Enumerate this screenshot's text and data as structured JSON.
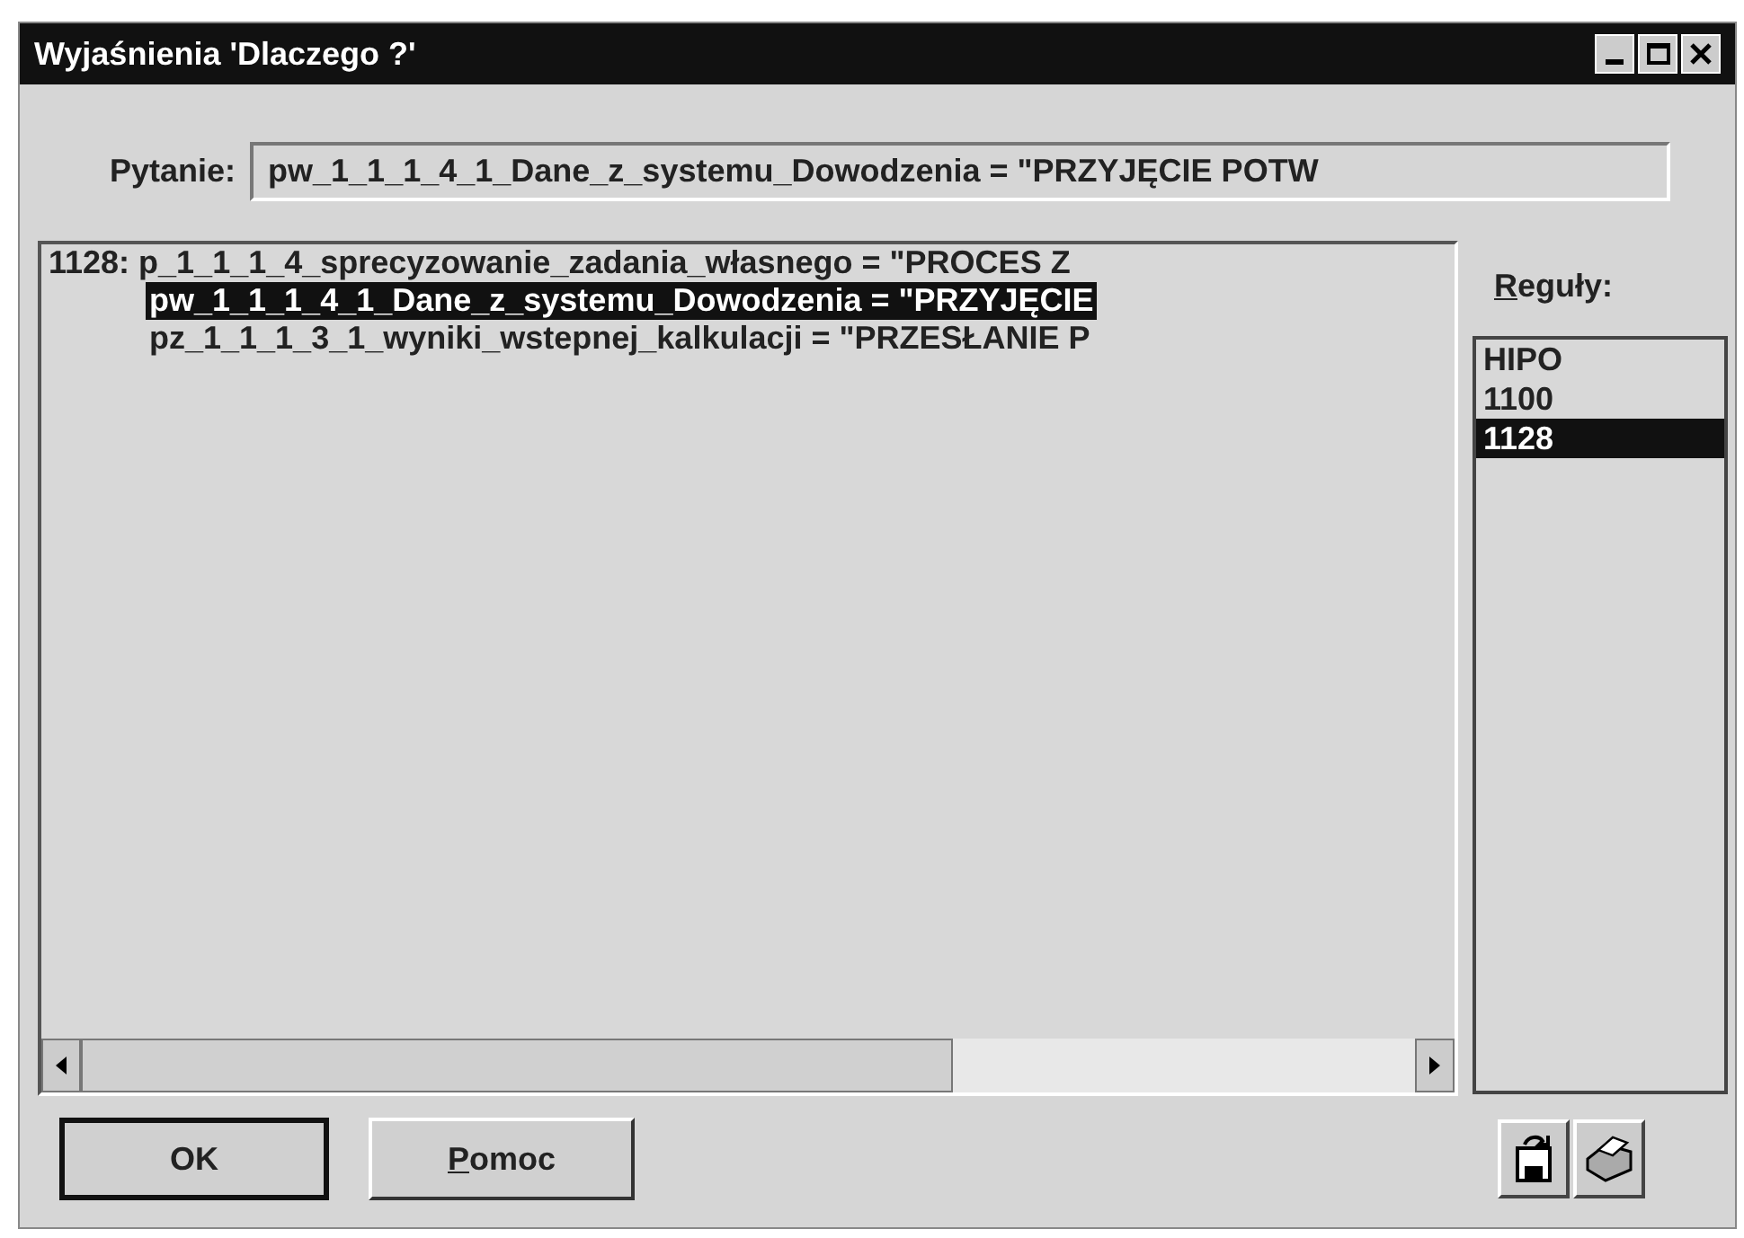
{
  "window": {
    "title": "Wyjaśnienia 'Dlaczego ?'"
  },
  "question": {
    "label": "Pytanie:",
    "value": "pw_1_1_1_4_1_Dane_z_systemu_Dowodzenia = \"PRZYJĘCIE POTW"
  },
  "tree": [
    {
      "text": "1128: p_1_1_1_4_sprecyzowanie_zadania_własnego = \"PROCES Z",
      "selected": false,
      "children": [
        {
          "text": "pw_1_1_1_4_1_Dane_z_systemu_Dowodzenia = \"PRZYJĘCIE",
          "selected": true
        },
        {
          "text": "pz_1_1_1_3_1_wyniki_wstepnej_kalkulacji = \"PRZESŁANIE P",
          "selected": false
        }
      ]
    }
  ],
  "rules": {
    "label": "Reguły:",
    "items": [
      {
        "text": "HIPO",
        "selected": false
      },
      {
        "text": "1100",
        "selected": false
      },
      {
        "text": "1128",
        "selected": true
      }
    ]
  },
  "buttons": [
    {
      "label": "OK",
      "default": true
    },
    {
      "label": "Pomoc",
      "default": false
    }
  ]
}
